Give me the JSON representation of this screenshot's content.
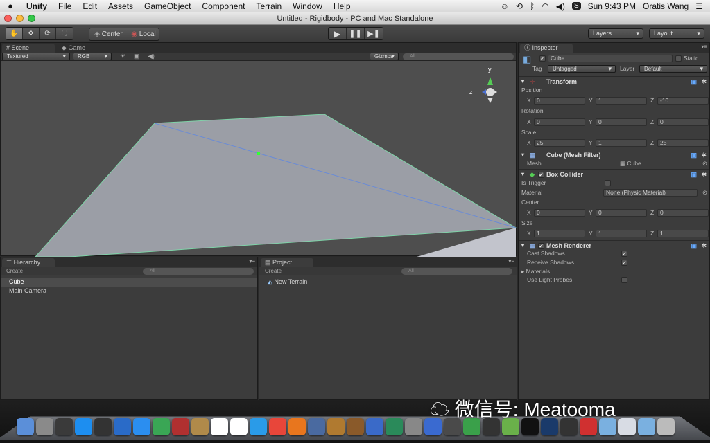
{
  "menubar": {
    "apple": "",
    "app": "Unity",
    "items": [
      "File",
      "Edit",
      "Assets",
      "GameObject",
      "Component",
      "Terrain",
      "Window",
      "Help"
    ],
    "clock": "Sun 9:43 PM",
    "user": "Oratis Wang"
  },
  "window": {
    "title": "Untitled - Rigidbody - PC and Mac Standalone"
  },
  "toolbar": {
    "pivot": "Center",
    "space": "Local",
    "layers": "Layers",
    "layout": "Layout"
  },
  "scene": {
    "tab_scene": "Scene",
    "tab_game": "Game",
    "render_mode": "Textured",
    "color_mode": "RGB",
    "gizmos": "Gizmos",
    "search": "All",
    "axis_y": "y",
    "axis_z": "z"
  },
  "hierarchy": {
    "tab": "Hierarchy",
    "create": "Create",
    "search": "All",
    "items": [
      "Cube",
      "Main Camera"
    ]
  },
  "project": {
    "tab": "Project",
    "create": "Create",
    "search": "All",
    "items": [
      "New Terrain"
    ]
  },
  "inspector": {
    "tab": "Inspector",
    "object_name": "Cube",
    "static": "Static",
    "tag_label": "Tag",
    "tag": "Untagged",
    "layer_label": "Layer",
    "layer": "Default",
    "transform": {
      "title": "Transform",
      "position_label": "Position",
      "rotation_label": "Rotation",
      "scale_label": "Scale",
      "position": [
        "0",
        "1",
        "-10"
      ],
      "rotation": [
        "0",
        "0",
        "0"
      ],
      "scale": [
        "25",
        "1",
        "25"
      ]
    },
    "mesh_filter": {
      "title": "Cube (Mesh Filter)",
      "mesh_label": "Mesh",
      "mesh": "Cube"
    },
    "box_collider": {
      "title": "Box Collider",
      "is_trigger": "Is Trigger",
      "material_label": "Material",
      "material": "None (Physic Material)",
      "center_label": "Center",
      "size_label": "Size",
      "center": [
        "0",
        "0",
        "0"
      ],
      "size": [
        "1",
        "1",
        "1"
      ]
    },
    "mesh_renderer": {
      "title": "Mesh Renderer",
      "cast_shadows": "Cast Shadows",
      "receive_shadows": "Receive Shadows",
      "materials": "Materials",
      "light_probes": "Use Light Probes"
    },
    "axes": [
      "X",
      "Y",
      "Z"
    ]
  },
  "watermark": "微信号: Meatooma",
  "dock_icons": [
    "finder-icon",
    "launchpad-icon",
    "dashboard-icon",
    "appstore-icon",
    "compass-icon",
    "preview-icon",
    "safari-icon",
    "facetime-icon",
    "photobooth-icon",
    "contacts-icon",
    "calendar-icon",
    "reminders-icon",
    "itunes-icon",
    "chrome-icon",
    "firefox-icon",
    "iphoto-icon",
    "garageband-icon",
    "guitar-icon",
    "xcode-icon",
    "timemachine-icon",
    "systemprefs-icon",
    "keynote-icon",
    "pen-icon",
    "numbers-icon",
    "activity-icon",
    "evernote-icon",
    "qq-icon",
    "photoshop-icon",
    "unity-icon",
    "wechat-icon",
    "folder-icon",
    "docs-icon",
    "downloads-icon",
    "trash-icon"
  ]
}
